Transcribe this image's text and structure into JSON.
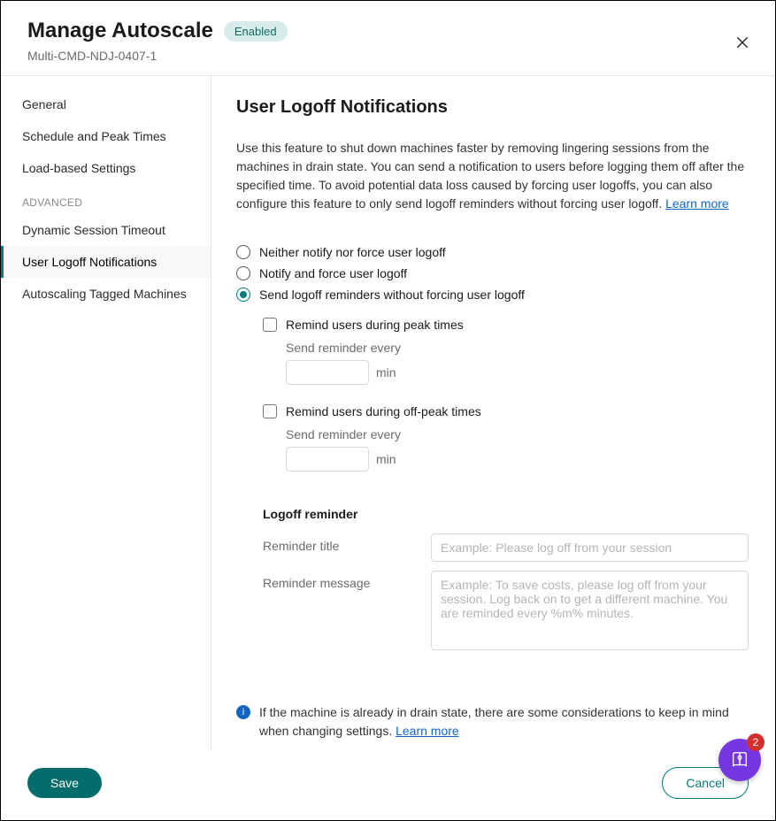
{
  "header": {
    "title": "Manage Autoscale",
    "status": "Enabled",
    "subtitle": "Multi-CMD-NDJ-0407-1"
  },
  "sidebar": {
    "items": [
      {
        "label": "General",
        "active": false
      },
      {
        "label": "Schedule and Peak Times",
        "active": false
      },
      {
        "label": "Load-based Settings",
        "active": false
      }
    ],
    "advanced_label": "ADVANCED",
    "advanced_items": [
      {
        "label": "Dynamic Session Timeout",
        "active": false
      },
      {
        "label": "User Logoff Notifications",
        "active": true
      },
      {
        "label": "Autoscaling Tagged Machines",
        "active": false
      }
    ]
  },
  "main": {
    "title": "User Logoff Notifications",
    "description": "Use this feature to shut down machines faster by removing lingering sessions from the machines in drain state. You can send a notification to users before logging them off after the specified time. To avoid potential data loss caused by forcing user logoffs, you can also configure this feature to only send logoff reminders without forcing user logoff. ",
    "learn_more": "Learn more",
    "radios": {
      "opt1": "Neither notify nor force user logoff",
      "opt2": "Notify and force user logoff",
      "opt3": "Send logoff reminders without forcing user logoff"
    },
    "peak": {
      "checkbox_label": "Remind users during peak times",
      "sub_label": "Send reminder every",
      "unit": "min",
      "value": ""
    },
    "offpeak": {
      "checkbox_label": "Remind users during off-peak times",
      "sub_label": "Send reminder every",
      "unit": "min",
      "value": ""
    },
    "reminder": {
      "heading": "Logoff reminder",
      "title_label": "Reminder title",
      "title_placeholder": "Example: Please log off from your session",
      "title_value": "",
      "message_label": "Reminder message",
      "message_placeholder": "Example: To save costs, please log off from your session. Log back on to get a different machine. You are reminded every %m% minutes.",
      "message_value": ""
    },
    "info": {
      "text": "If the machine is already in drain state, there are some considerations to keep in mind when changing settings. ",
      "link": "Learn more"
    }
  },
  "footer": {
    "save": "Save",
    "cancel": "Cancel"
  },
  "fab": {
    "badge": "2"
  }
}
